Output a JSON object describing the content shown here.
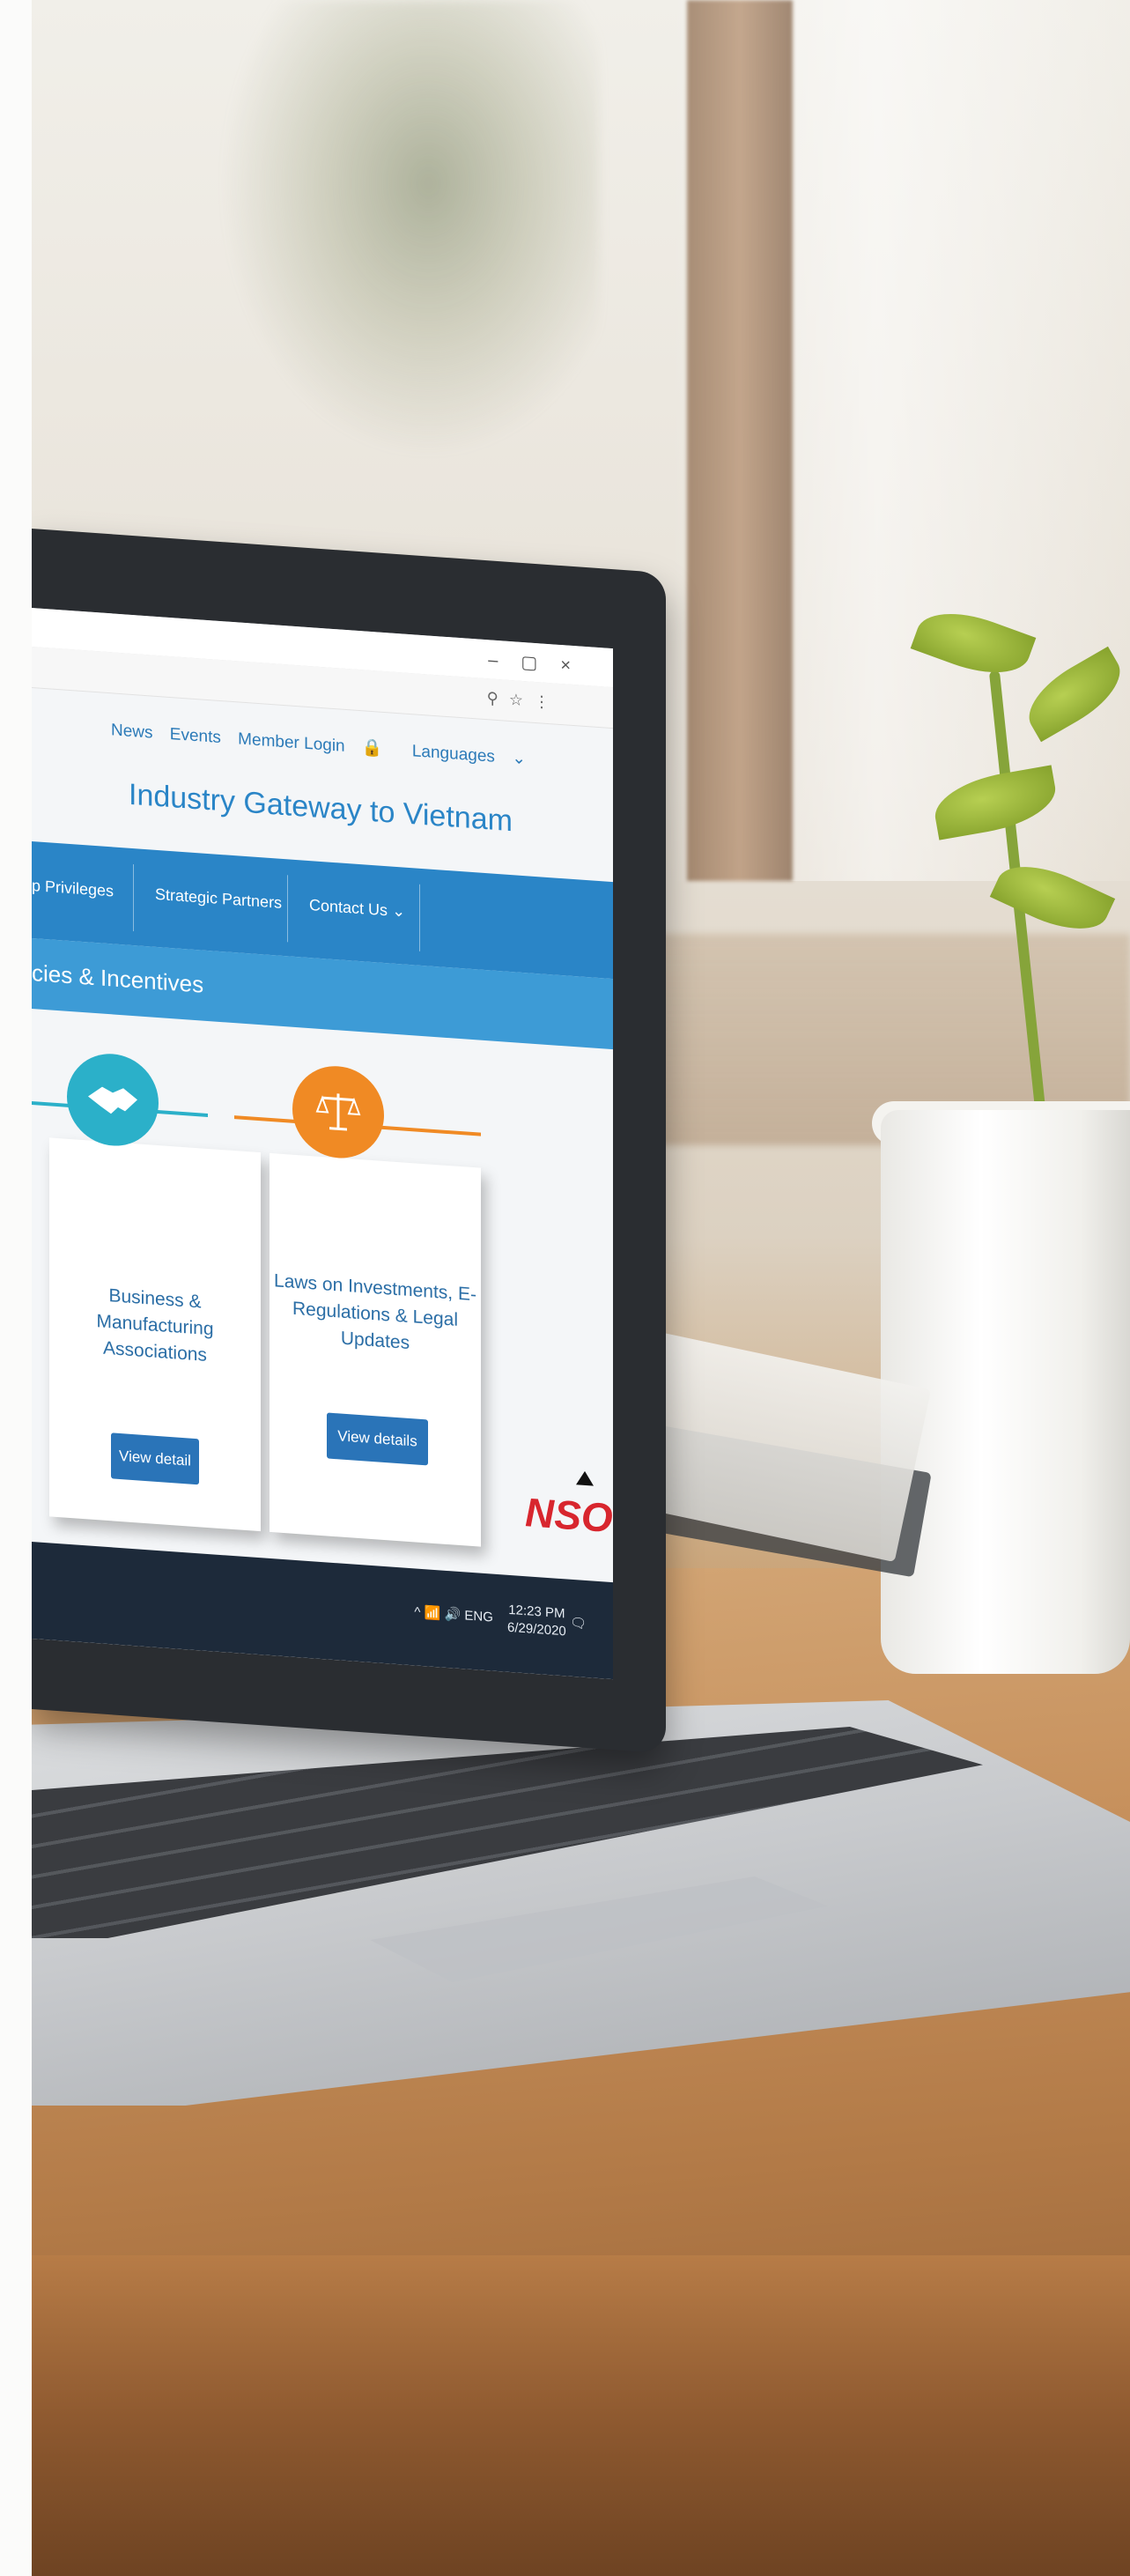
{
  "screen": {
    "top_nav": [
      "News",
      "Events",
      "Member Login",
      "Languages"
    ],
    "site_title": "Industry Gateway to Vietnam",
    "main_nav": [
      "p Privileges",
      "Strategic Partners",
      "Contact Us"
    ],
    "section_heading": "cies & Incentives",
    "cards": [
      {
        "title_line1": "Business & Manufacturing",
        "title_line2": "Associations",
        "button": "View detail",
        "accent": "#2bb0c9",
        "icon": "handshake-icon"
      },
      {
        "title_line1": "Laws on Investments, E-",
        "title_line2": "Regulations & Legal",
        "title_line3": "Updates",
        "button": "View details",
        "accent": "#f08a24",
        "icon": "scales-icon"
      }
    ],
    "tray": {
      "lang": "ENG",
      "time": "12:23 PM",
      "date": "6/29/2020"
    },
    "logo_text": "NSO"
  }
}
